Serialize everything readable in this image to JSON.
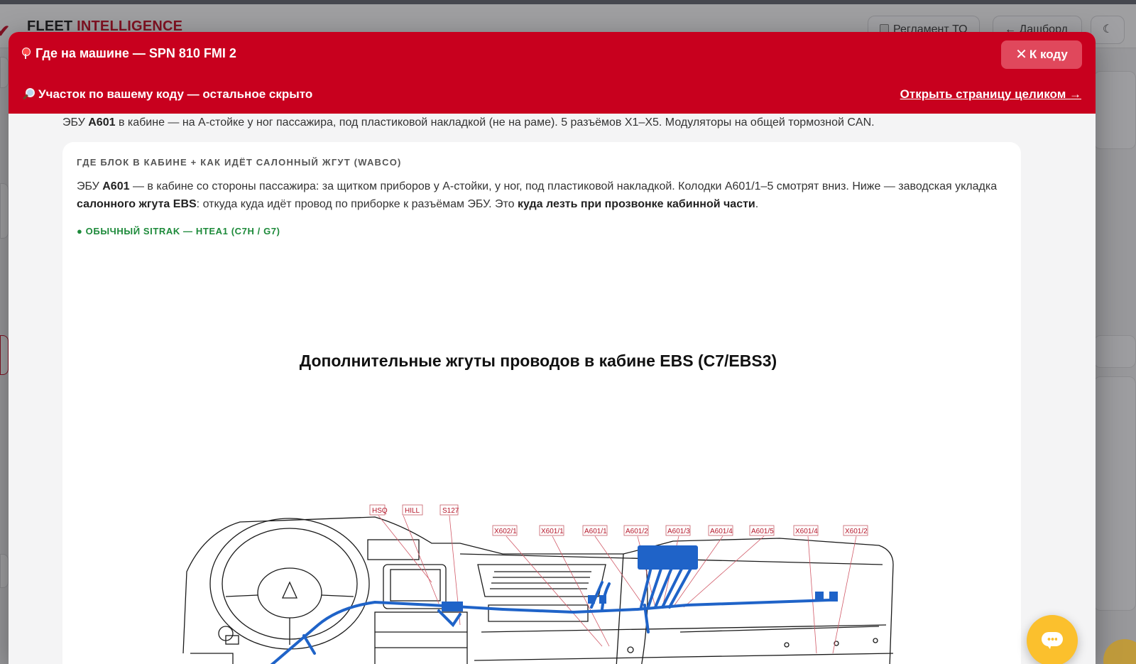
{
  "app": {
    "title_primary": "FLEET",
    "title_accent": "INTELLIGENCE",
    "buttons": {
      "reglament": "Регламент ТО",
      "dashboard": "← Дашборд",
      "theme": "☾"
    }
  },
  "modal": {
    "title": "Где на машине — SPN 810 FMI 2",
    "close_label": "К коду",
    "subtitle": "Участок по вашему коду — остальное скрыто",
    "open_full_label": "Открыть страницу целиком →",
    "intro": {
      "t1": "ЭБУ ",
      "b1": "A601",
      "t2": " в кабине — на А-стойке у ног пассажира, под пластиковой накладкой (не на раме). 5 разъёмов X1–X5. Модуляторы на общей тормозной CAN."
    },
    "card": {
      "heading": "ГДЕ БЛОК В КАБИНЕ + КАК ИДЁТ САЛОННЫЙ ЖГУТ (WABCO)",
      "desc": {
        "t1": "ЭБУ ",
        "b1": "A601",
        "t2": " — в кабине со стороны пассажира: за щитком приборов у А-стойки, у ног, под пластиковой накладкой. Колодки A601/1–5 смотрят вниз. Ниже — заводская укладка ",
        "b2": "салонного жгута EBS",
        "t3": ": откуда куда идёт провод по приборке к разъёмам ЭБУ. Это ",
        "b3": "куда лезть при прозвонке кабинной части",
        "t4": "."
      },
      "variant_label": "● ОБЫЧНЫЙ SITRAK — HTEA1 (C7H / G7)",
      "diagram": {
        "title": "Дополнительные жгуты проводов в кабине EBS (C7/EBS3)",
        "callouts_left": [
          "HSQ",
          "HILL",
          "S127"
        ],
        "callouts_right": [
          "X602/1",
          "X601/1",
          "A601/1",
          "A601/2",
          "A601/3",
          "A601/4",
          "A601/5",
          "X601/4",
          "X601/2"
        ],
        "harness_color": "#1f63c8",
        "callout_color": "#b5172a"
      }
    }
  },
  "colors": {
    "header_red": "#c8001e",
    "variant_green": "#1d8a3a",
    "chat_yellow": "#fbc02d"
  }
}
